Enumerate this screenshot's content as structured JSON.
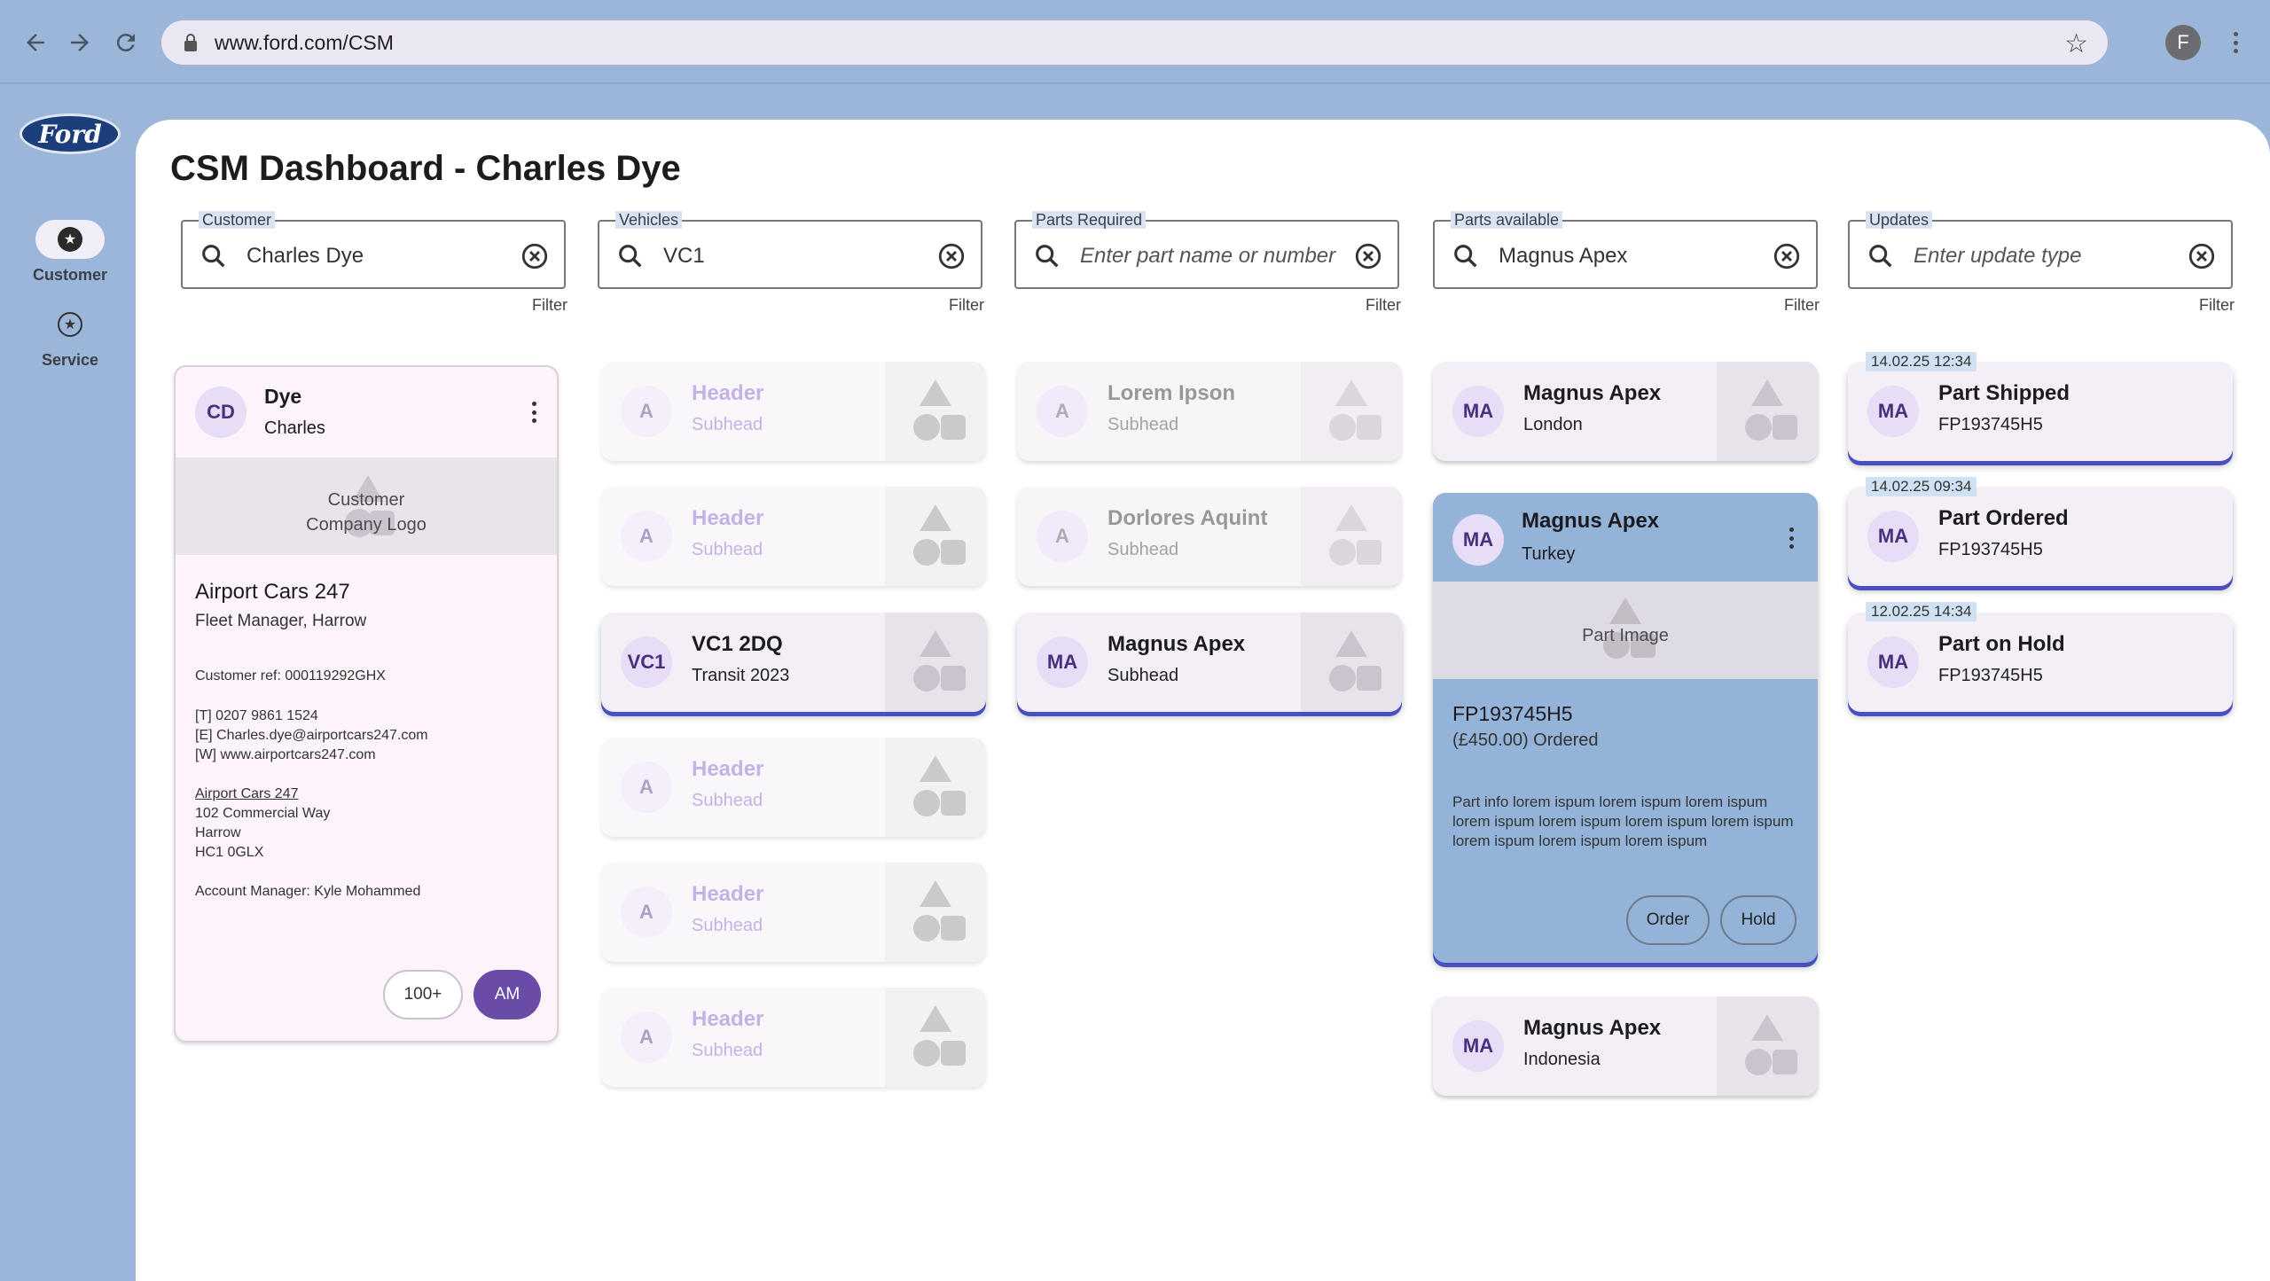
{
  "browser": {
    "url": "www.ford.com/CSM",
    "profile_initial": "F"
  },
  "rail": {
    "logo": "Ford",
    "items": [
      {
        "label": "Customer",
        "active": true
      },
      {
        "label": "Service",
        "active": false
      }
    ]
  },
  "page": {
    "title": "CSM Dashboard - Charles Dye"
  },
  "filters": [
    {
      "label": "Customer",
      "value": "Charles Dye",
      "placeholder": "",
      "hint": "Filter"
    },
    {
      "label": "Vehicles",
      "value": "VC1",
      "placeholder": "",
      "hint": "Filter"
    },
    {
      "label": "Parts Required",
      "value": "",
      "placeholder": "Enter part name or number",
      "hint": "Filter"
    },
    {
      "label": "Parts available",
      "value": "Magnus Apex",
      "placeholder": "",
      "hint": "Filter"
    },
    {
      "label": "Updates",
      "value": "",
      "placeholder": "Enter update type",
      "hint": "Filter"
    }
  ],
  "customer_card": {
    "initials": "CD",
    "surname": "Dye",
    "first_name": "Charles",
    "logo_text": "Customer\nCompany Logo",
    "company": "Airport Cars 247",
    "role": "Fleet Manager, Harrow",
    "ref": "Customer ref: 000119292GHX",
    "phone": "[T] 0207 9861 1524",
    "email": "[E] Charles.dye@airportcars247.com",
    "web": "[W] www.airportcars247.com",
    "address_name": "Airport Cars 247",
    "address_line1": "102 Commercial Way",
    "address_city": "Harrow",
    "address_postcode": "HC1 0GLX",
    "account_manager": "Account Manager: Kyle Mohammed",
    "chip_count": "100+",
    "chip_manager": "AM"
  },
  "vehicles": [
    {
      "initials": "A",
      "title": "Header",
      "sub": "Subhead",
      "state": "faded"
    },
    {
      "initials": "A",
      "title": "Header",
      "sub": "Subhead",
      "state": "faded"
    },
    {
      "initials": "VC1",
      "title": "VC1 2DQ",
      "sub": "Transit 2023",
      "state": "selected"
    },
    {
      "initials": "A",
      "title": "Header",
      "sub": "Subhead",
      "state": "faded"
    },
    {
      "initials": "A",
      "title": "Header",
      "sub": "Subhead",
      "state": "faded"
    },
    {
      "initials": "A",
      "title": "Header",
      "sub": "Subhead",
      "state": "faded"
    }
  ],
  "parts_required": [
    {
      "initials": "A",
      "title": "Lorem Ipson",
      "sub": "Subhead",
      "state": "dim"
    },
    {
      "initials": "A",
      "title": "Dorlores Aquint",
      "sub": "Subhead",
      "state": "dim"
    },
    {
      "initials": "MA",
      "title": "Magnus Apex",
      "sub": "Subhead",
      "state": "selected"
    }
  ],
  "parts_available": {
    "top": {
      "initials": "MA",
      "title": "Magnus Apex",
      "sub": "London"
    },
    "expanded": {
      "initials": "MA",
      "title": "Magnus Apex",
      "sub": "Turkey",
      "image_text": "Part Image",
      "part_number": "FP193745H5",
      "status": "(£450.00) Ordered",
      "info": "Part info lorem ispum lorem ispum lorem ispum lorem ispum lorem ispum lorem ispum lorem ispum lorem ispum lorem ispum lorem ispum",
      "order_label": "Order",
      "hold_label": "Hold"
    },
    "bottom": {
      "initials": "MA",
      "title": "Magnus Apex",
      "sub": "Indonesia"
    }
  },
  "updates": [
    {
      "timestamp": "14.02.25 12:34",
      "initials": "MA",
      "title": "Part Shipped",
      "sub": "FP193745H5"
    },
    {
      "timestamp": "14.02.25 09:34",
      "initials": "MA",
      "title": "Part Ordered",
      "sub": "FP193745H5"
    },
    {
      "timestamp": "12.02.25 14:34",
      "initials": "MA",
      "title": "Part on Hold",
      "sub": "FP193745H5"
    }
  ],
  "colors": {
    "background": "#9bb6d8",
    "accent": "#6a4ba6",
    "selected_shadow": "#4a4fbf",
    "expanded_card": "#94b3d8"
  }
}
